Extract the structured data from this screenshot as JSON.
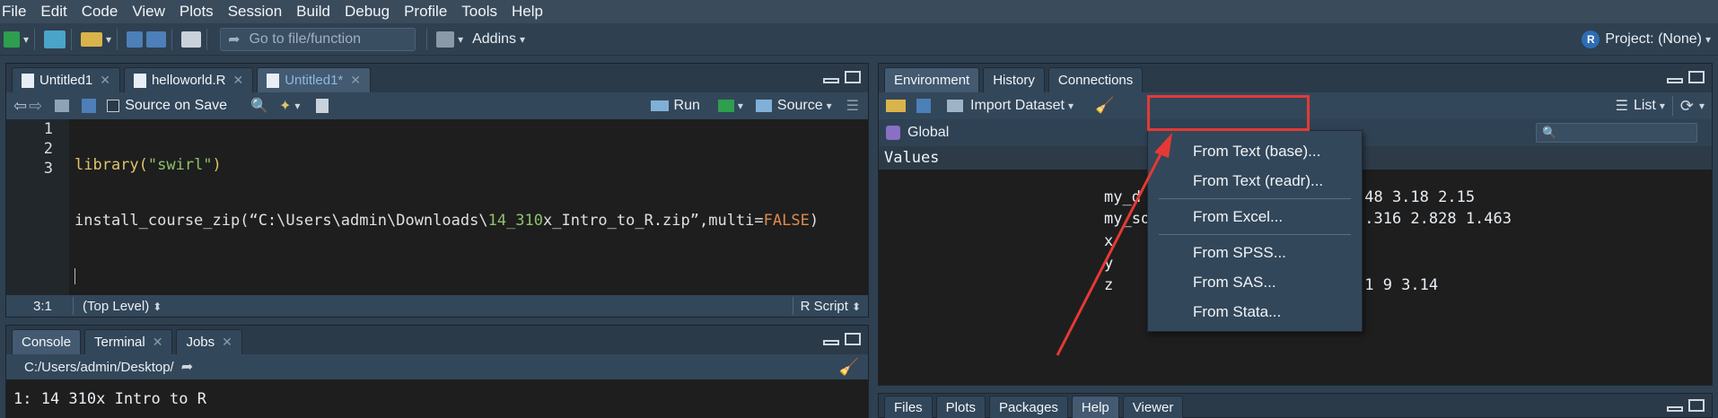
{
  "menu": [
    "File",
    "Edit",
    "Code",
    "View",
    "Plots",
    "Session",
    "Build",
    "Debug",
    "Profile",
    "Tools",
    "Help"
  ],
  "toolbar": {
    "goto_placeholder": "Go to file/function",
    "addins": "Addins",
    "project": "Project: (None)"
  },
  "editor": {
    "tabs": [
      {
        "label": "Untitled1",
        "active": false
      },
      {
        "label": "helloworld.R",
        "active": false
      },
      {
        "label": "Untitled1*",
        "active": true
      }
    ],
    "source_on_save": "Source on Save",
    "run": "Run",
    "source": "Source",
    "line_numbers": [
      "1",
      "2",
      "3"
    ],
    "line1": {
      "fn": "library(",
      "arg": "\"swirl\"",
      "close": ")"
    },
    "line2": {
      "a": "install_course_zip(“C:\\Users\\admin\\Downloads\\",
      "b": "14_310",
      "c": "x_Intro_to_R.zip”,multi=",
      "d": "FALSE",
      ")": ")"
    },
    "position": "3:1",
    "scope": "(Top Level)",
    "filetype": "R Script"
  },
  "console": {
    "tabs": [
      {
        "label": "Console",
        "active": true
      },
      {
        "label": "Terminal",
        "active": false
      },
      {
        "label": "Jobs",
        "active": false
      }
    ],
    "path": "C:/Users/admin/Desktop/",
    "line1": "1: 14 310x Intro to R"
  },
  "environment": {
    "tabs": [
      {
        "label": "Environment",
        "active": true
      },
      {
        "label": "History",
        "active": false
      },
      {
        "label": "Connections",
        "active": false
      }
    ],
    "import_dataset": "Import Dataset",
    "list": "List",
    "global": "Global",
    "values_header": "Values",
    "rows": [
      {
        "name": "my_d",
        "value": ".48 3.18 2.15"
      },
      {
        "name": "my_so",
        "value": ").316 2.828 1.463"
      },
      {
        "name": "x",
        "value": ""
      },
      {
        "name": "y",
        "value": ""
      },
      {
        "name": "z",
        "value": ".1 9 3.14"
      }
    ]
  },
  "import_menu": [
    "From Text (base)...",
    "From Text (readr)...",
    "From Excel...",
    "From SPSS...",
    "From SAS...",
    "From Stata..."
  ],
  "files_pane": {
    "tabs": [
      "Files",
      "Plots",
      "Packages",
      "Help",
      "Viewer"
    ],
    "active": "Help"
  },
  "colors": {
    "annotation": "#e53935",
    "accent": "#8fb6e0"
  }
}
